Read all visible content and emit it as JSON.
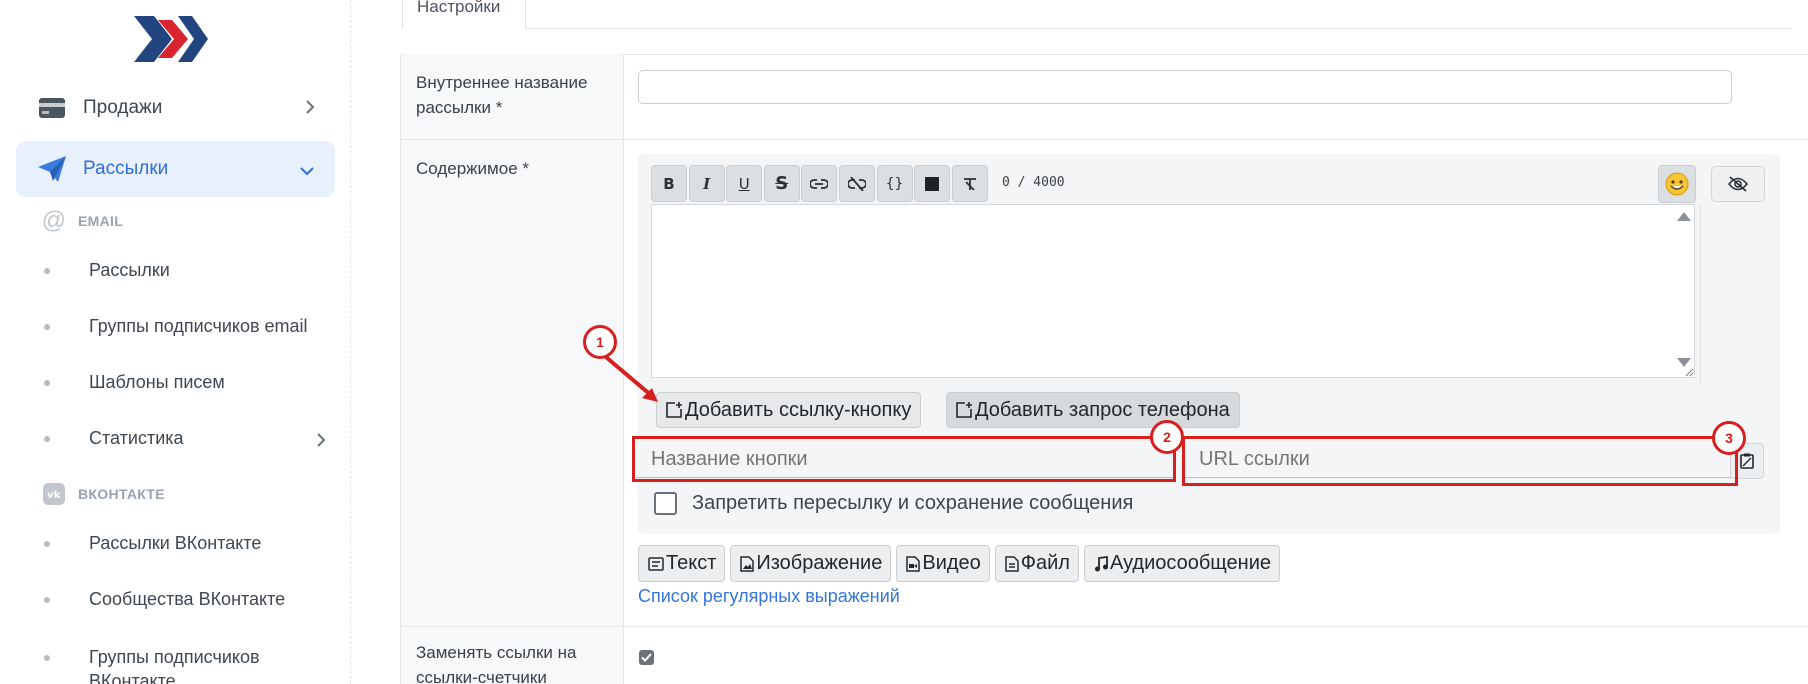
{
  "sidebar": {
    "items": [
      {
        "label": "Продажи",
        "icon": "credit-card-icon"
      },
      {
        "label": "Рассылки",
        "icon": "paper-plane-icon"
      }
    ],
    "email_section": {
      "title": "EMAIL",
      "items": [
        "Рассылки",
        "Группы подписчиков email",
        "Шаблоны писем",
        "Статистика"
      ]
    },
    "vk_section": {
      "title": "ВКОНТАКТЕ",
      "items": [
        "Рассылки ВКонтакте",
        "Сообщества ВКонтакте",
        "Группы подписчиков ВКонтакте"
      ]
    }
  },
  "tabs": {
    "settings": "Настройки"
  },
  "form": {
    "internal_name_label": "Внутреннее название рассылки *",
    "content_label": "Содержимое *",
    "counter": "0 / 4000",
    "add_link_button": "Добавить ссылку-кнопку",
    "add_phone_button": "Добавить запрос телефона",
    "button_name_placeholder": "Название кнопки",
    "url_placeholder": "URL ссылки",
    "forbid_forward_label": "Запретить пересылку и сохранение сообщения",
    "type_buttons": [
      "Текст",
      "Изображение",
      "Видео",
      "Файл",
      "Аудиосообщение"
    ],
    "regex_link": "Список регулярных выражений",
    "replace_links_label": "Заменять ссылки на ссылки-счетчики",
    "replace_links_checked": true
  },
  "toolbar": {
    "buttons": [
      "B",
      "I",
      "U",
      "S",
      "link",
      "unlink",
      "{}",
      "spoiler",
      "clear-format"
    ]
  },
  "annotations": [
    "1",
    "2",
    "3"
  ],
  "colors": {
    "accent": "#2f6fd8",
    "annotation": "#d91e1e",
    "active_bg": "#e8f0fb"
  }
}
